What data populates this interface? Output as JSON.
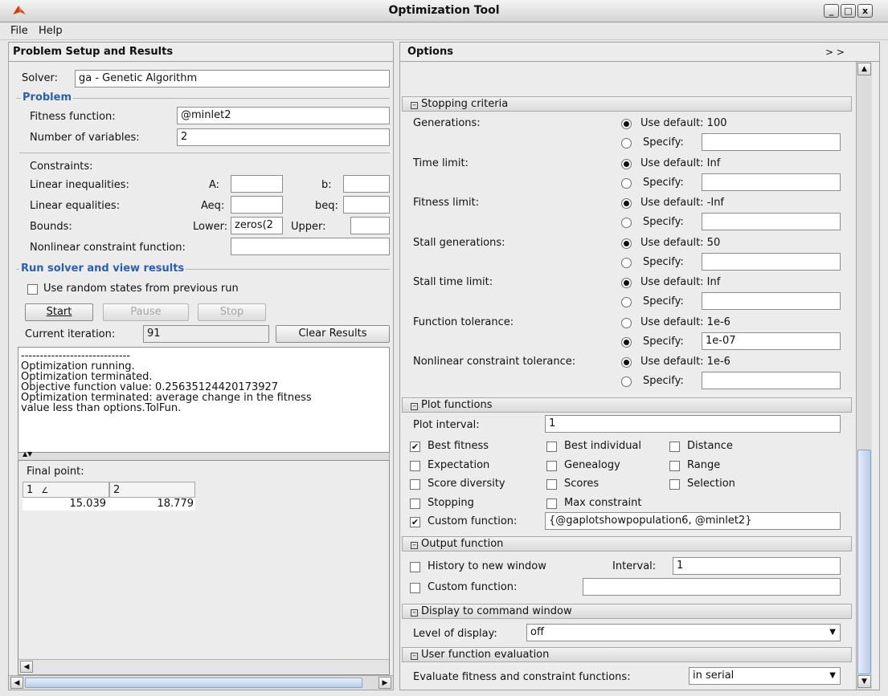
{
  "window": {
    "title": "Optimization Tool",
    "controls": [
      "_",
      "□",
      "x"
    ]
  },
  "menu": {
    "file": "File",
    "help": "Help"
  },
  "left": {
    "header": "Problem Setup and Results",
    "solver_label": "Solver:",
    "solver_value": "ga - Genetic Algorithm",
    "problem_section": "Problem",
    "fitness_label": "Fitness function:",
    "fitness_value": "@minlet2",
    "nvars_label": "Number of variables:",
    "nvars_value": "2",
    "constraints_label": "Constraints:",
    "lin_ineq_label": "Linear inequalities:",
    "a_label": "A:",
    "b_label": "b:",
    "lin_eq_label": "Linear equalities:",
    "aeq_label": "Aeq:",
    "beq_label": "beq:",
    "bounds_label": "Bounds:",
    "lower_label": "Lower:",
    "lower_value": "zeros(2",
    "upper_label": "Upper:",
    "nonlin_label": "Nonlinear constraint function:",
    "run_section": "Run solver and view results",
    "random_states_label": "Use random states from previous run",
    "start_label": "Start",
    "pause_label": "Pause",
    "stop_label": "Stop",
    "current_iter_label": "Current iteration:",
    "current_iter_value": "91",
    "clear_results_label": "Clear Results",
    "output_lines": [
      "-----------------------------",
      "Optimization running.",
      "Optimization terminated.",
      "Objective function value: 0.25635124420173927",
      "Optimization terminated: average change in the fitness",
      "value less than options.TolFun."
    ],
    "final_point_label": "Final point:",
    "final_point_cols": [
      "1",
      "2"
    ],
    "final_point_values": [
      "15.039",
      "18.779"
    ]
  },
  "right": {
    "header": "Options",
    "expand_label": "> >",
    "stopping": {
      "title": "Stopping criteria",
      "rows": [
        {
          "label": "Generations:",
          "default": "Use default: 100",
          "specify": "Specify:",
          "value": "",
          "selected": "default"
        },
        {
          "label": "Time limit:",
          "default": "Use default: Inf",
          "specify": "Specify:",
          "value": "",
          "selected": "default"
        },
        {
          "label": "Fitness limit:",
          "default": "Use default: -Inf",
          "specify": "Specify:",
          "value": "",
          "selected": "default"
        },
        {
          "label": "Stall generations:",
          "default": "Use default: 50",
          "specify": "Specify:",
          "value": "",
          "selected": "default"
        },
        {
          "label": "Stall time limit:",
          "default": "Use default: Inf",
          "specify": "Specify:",
          "value": "",
          "selected": "default"
        },
        {
          "label": "Function tolerance:",
          "default": "Use default: 1e-6",
          "specify": "Specify:",
          "value": "1e-07",
          "selected": "specify"
        },
        {
          "label": "Nonlinear constraint tolerance:",
          "default": "Use default: 1e-6",
          "specify": "Specify:",
          "value": "",
          "selected": "default"
        }
      ]
    },
    "plot": {
      "title": "Plot functions",
      "interval_label": "Plot interval:",
      "interval_value": "1",
      "checks": [
        {
          "label": "Best fitness",
          "checked": true
        },
        {
          "label": "Best individual",
          "checked": false
        },
        {
          "label": "Distance",
          "checked": false
        },
        {
          "label": "Expectation",
          "checked": false
        },
        {
          "label": "Genealogy",
          "checked": false
        },
        {
          "label": "Range",
          "checked": false
        },
        {
          "label": "Score diversity",
          "checked": false
        },
        {
          "label": "Scores",
          "checked": false
        },
        {
          "label": "Selection",
          "checked": false
        },
        {
          "label": "Stopping",
          "checked": false
        },
        {
          "label": "Max constraint",
          "checked": false
        }
      ],
      "custom_label": "Custom function:",
      "custom_value": "{@gaplotshowpopulation6, @minlet2}"
    },
    "output": {
      "title": "Output function",
      "history_label": "History to new window",
      "interval_label": "Interval:",
      "interval_value": "1",
      "custom_label": "Custom function:",
      "custom_value": ""
    },
    "display": {
      "title": "Display to command window",
      "level_label": "Level of display:",
      "level_value": "off"
    },
    "user_eval": {
      "title": "User function evaluation",
      "eval_label": "Evaluate fitness and constraint functions:",
      "eval_value": "in serial"
    }
  }
}
